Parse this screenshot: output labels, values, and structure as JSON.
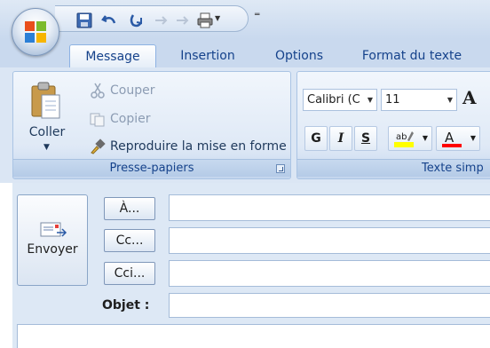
{
  "tabs": [
    "Message",
    "Insertion",
    "Options",
    "Format du texte"
  ],
  "ribbon": {
    "clipboard": {
      "paste_label": "Coller",
      "cut_label": "Couper",
      "copy_label": "Copier",
      "format_painter_label": "Reproduire la mise en forme",
      "group_label": "Presse-papiers"
    },
    "basic_text": {
      "font_name": "Calibri (C",
      "font_size": "11",
      "bold_label": "G",
      "italic_label": "I",
      "underline_label": "S",
      "grow_font_label": "A",
      "group_label": "Texte simp"
    }
  },
  "compose": {
    "send_label": "Envoyer",
    "to_label": "À...",
    "cc_label": "Cc...",
    "bcc_label": "Cci...",
    "subject_label": "Objet :",
    "to_value": "",
    "cc_value": "",
    "bcc_value": "",
    "subject_value": ""
  },
  "colors": {
    "ribbon_blue": "#dbe6f4",
    "tab_text": "#15428b",
    "highlight_yellow": "#ffff00",
    "font_color_red": "#ff0000"
  }
}
